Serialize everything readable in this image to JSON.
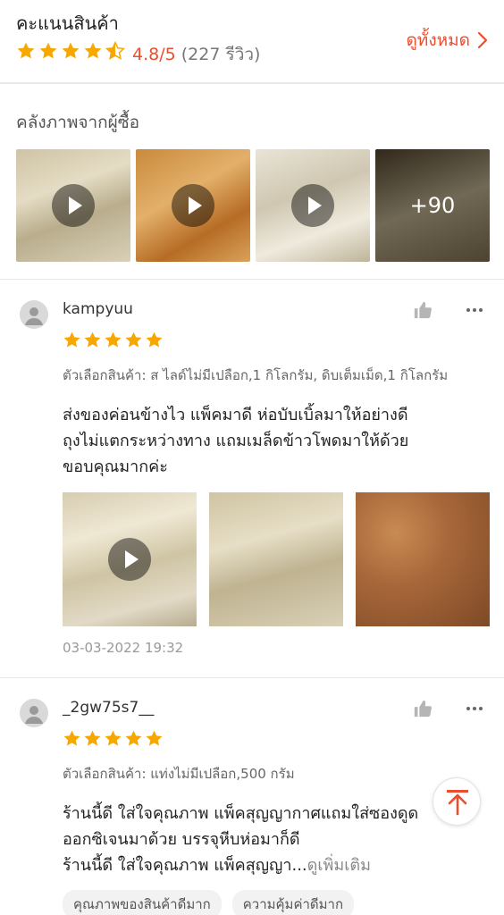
{
  "header": {
    "title": "คะแนนสินค้า",
    "rating": "4.8/5",
    "review_count": "(227 รีวิว)",
    "see_all": "ดูทั้งหมด",
    "stars": 4.5,
    "accent_color": "#ee4d2d",
    "star_color": "#f6a700"
  },
  "gallery": {
    "title": "คลังภาพจากผู้ซื้อ",
    "more_count": "+90",
    "items": [
      {
        "type": "video",
        "icon": "play-icon"
      },
      {
        "type": "video",
        "icon": "play-icon"
      },
      {
        "type": "video",
        "icon": "play-icon"
      },
      {
        "type": "more"
      }
    ]
  },
  "reviews": [
    {
      "username": "kampyuu",
      "stars": 5,
      "variation": "ตัวเลือกสินค้า: ส ไลด์ไม่มีเปลือก,1 กิโลกรัม, ดิบเต็มเม็ด,1 กิโลกรัม",
      "text_lines": [
        "ส่งของค่อนข้างไว แพ็คมาดี ห่อบับเบิ้ลมาให้อย่างดี",
        "ถุงไม่แตกระหว่างทาง แถมเมล็ดข้าวโพดมาให้ด้วย",
        "ขอบคุณมากค่ะ"
      ],
      "photos": [
        {
          "type": "video"
        },
        {
          "type": "image"
        },
        {
          "type": "image"
        }
      ],
      "date": "03-03-2022 19:32"
    },
    {
      "username": "_2gw75s7__",
      "stars": 5,
      "variation": "ตัวเลือกสินค้า: แท่งไม่มีเปลือก,500 กรัม",
      "text_lines": [
        "ร้านนี้ดี ใส่ใจคุณภาพ แพ็คสุญญากาศแถมใส่ซองดูด",
        "ออกซิเจนมาด้วย บรรจุหีบห่อมาก็ดี",
        "ร้านนี้ดี ใส่ใจคุณภาพ แพ็คสุญญา..."
      ],
      "see_more": "ดูเพิ่มเติม",
      "tags": [
        "คุณภาพของสินค้าดีมาก",
        "ความคุ้มค่าดีมาก"
      ]
    }
  ]
}
